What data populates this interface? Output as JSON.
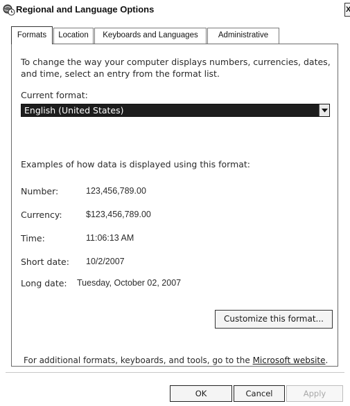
{
  "window": {
    "title": "Regional and Language Options",
    "close_glyph": "X"
  },
  "tabs": [
    {
      "label": "Formats",
      "active": true
    },
    {
      "label": "Location",
      "active": false
    },
    {
      "label": "Keyboards and Languages",
      "active": false
    },
    {
      "label": "Administrative",
      "active": false
    }
  ],
  "formats": {
    "intro": "To change the way your computer displays numbers, currencies, dates, and time, select an entry from the format list.",
    "current_format_label": "Current format:",
    "current_format_value": "English (United States)",
    "examples_heading": "Examples of how data is displayed using this format:",
    "examples": [
      {
        "label": "Number:",
        "value": "123,456,789.00"
      },
      {
        "label": "Currency:",
        "value": "$123,456,789.00"
      },
      {
        "label": "Time:",
        "value": "11:06:13 AM"
      },
      {
        "label": "Short date:",
        "value": "10/2/2007"
      },
      {
        "label": "Long date:",
        "value": "Tuesday, October 02, 2007"
      }
    ],
    "customize_button": "Customize this format...",
    "footer_text": "For additional formats, keyboards, and tools, go to the ",
    "footer_link": "Microsoft website",
    "footer_end": "."
  },
  "buttons": {
    "ok": "OK",
    "cancel": "Cancel",
    "apply": "Apply"
  },
  "icons": {
    "app": "globe-clock-icon",
    "dropdown": "chevron-down-icon"
  }
}
